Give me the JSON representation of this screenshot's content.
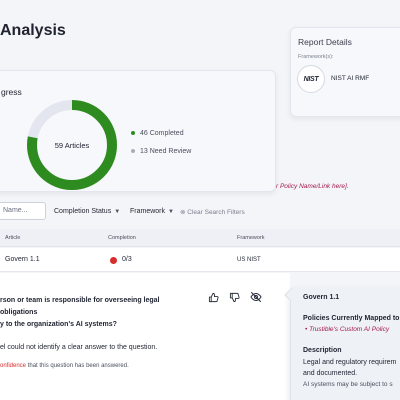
{
  "page": {
    "title": "Analysis"
  },
  "progress": {
    "header": "gress",
    "center_label": "59 Articles",
    "total": 59,
    "completed_value": 46,
    "review_value": 13,
    "completed_label": "46 Completed",
    "review_label": "13 Need Review",
    "completed_color": "#2e8b1f",
    "review_color": "#e3e6ee"
  },
  "report": {
    "header": "Report Details",
    "framework_label": "Framework(s):",
    "logo_text": "NIST",
    "framework_name": "NIST AI RMF"
  },
  "policy_link": "r Policy Name/Link here].",
  "filters": {
    "search_value": "Name...",
    "completion_status": "Completion Status",
    "framework": "Framework",
    "clear": "Clear Search Filters"
  },
  "table": {
    "headers": {
      "article": "Article",
      "completion": "Completion",
      "framework": "Framework"
    },
    "row": {
      "article": "Govern 1.1",
      "completion": "0/3",
      "framework": "US NIST",
      "status_color": "#d62d2d"
    }
  },
  "detail": {
    "question_line1": "rson or team is responsible for overseeing legal obligations",
    "question_line2": "y to the organization's AI systems?",
    "answer": "el could not identify a clear answer to the question.",
    "confidence_highlight": "onfidence",
    "confidence_rest": " that this question has been answered."
  },
  "side_panel": {
    "title": "Govern 1.1",
    "policies_label": "Policies Currently Mapped to",
    "policy_item": "Trustible's Custom AI Policy",
    "description_label": "Description",
    "description_line1": "Legal and regulatory requirem",
    "description_line2": "and documented.",
    "description_line3": "AI systems may be subject to s"
  }
}
